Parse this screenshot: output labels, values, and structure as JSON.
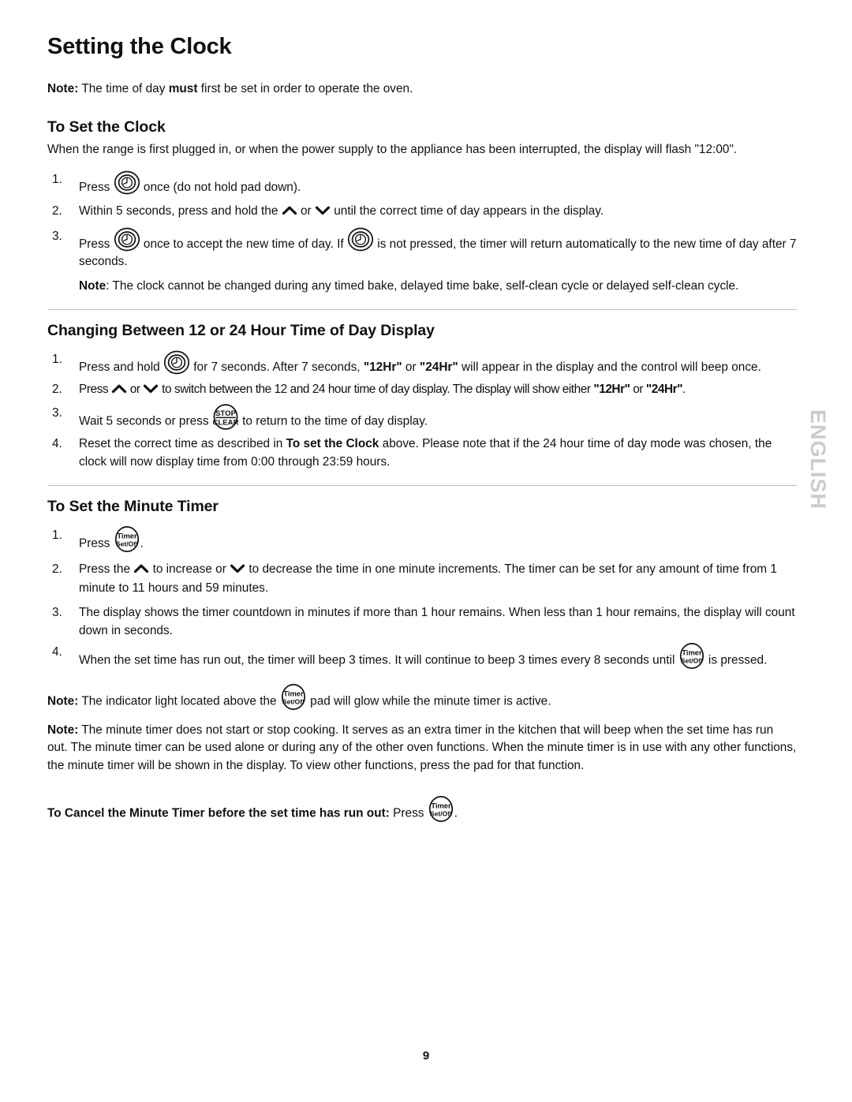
{
  "document": {
    "title": "Setting the Clock",
    "page_number": "9",
    "side_tab_label": "ENGLISH"
  },
  "intro_note": {
    "lead": "Note:",
    "text_before_bold": " The time of day ",
    "bold": "must",
    "text_after_bold": " first be set in order to operate the oven."
  },
  "sections": [
    {
      "heading": "To Set the Clock",
      "intro": "When the range is first plugged in, or when the power supply to the appliance has been interrupted, the display will flash \"12:00\".",
      "steps": [
        {
          "num": "1.",
          "parts": [
            "Press ",
            "[clock-pad-icon]",
            " once (do not hold pad down)."
          ]
        },
        {
          "num": "2.",
          "parts": [
            "Within 5 seconds, press and hold the ",
            "[chevron-up-icon]",
            " or ",
            "[chevron-down-icon]",
            " until the correct time of day appears in the display."
          ]
        },
        {
          "num": "3.",
          "parts": [
            "Press ",
            "[clock-pad-icon]",
            " once to accept the new time of day. If ",
            "[clock-pad-icon]",
            " is not pressed, the timer will return automatically to the new time of day after 7 seconds."
          ]
        }
      ],
      "sub_note": {
        "lead": "Note",
        "text": ": The clock cannot be changed during any timed bake, delayed time bake, self-clean cycle or delayed self-clean cycle."
      }
    },
    {
      "heading": "Changing Between 12 or 24 Hour Time of Day Display",
      "steps": [
        {
          "num": "1.",
          "text_1": "Press and hold ",
          "icon": "[clock-pad-icon]",
          "text_2": " for 7 seconds. After 7 seconds, ",
          "q1": "\"12Hr\"",
          "text_3": " or ",
          "q2": "\"24Hr\"",
          "text_4": " will appear in the display and the control will beep once."
        },
        {
          "num": "2.",
          "text_1": "Press ",
          "icon_up": "[chevron-up-icon]",
          "text_2": " or ",
          "icon_down": "[chevron-down-icon]",
          "text_3": " to switch between the 12 and 24 hour time of day display. The display will show either ",
          "q1": "\"12Hr\"",
          "text_4": " or ",
          "q2": "\"24Hr\"",
          "text_5": "."
        },
        {
          "num": "3.",
          "text_1": "Wait 5 seconds or press ",
          "icon": "[stop-clear-pad-icon]",
          "text_2": " to return to the time of day display."
        },
        {
          "num": "4.",
          "text_1": "Reset the correct time as described in ",
          "bold": "To set the Clock",
          "text_2": " above. Please note that if the 24 hour time of day mode was chosen, the clock will now display time from 0:00 through 23:59 hours."
        }
      ]
    },
    {
      "heading": "To Set the Minute Timer",
      "steps": [
        {
          "num": "1.",
          "text_1": "Press ",
          "icon": "[timer-set-off-pad-icon]",
          "text_2": "."
        },
        {
          "num": "2.",
          "text_1": "Press the ",
          "icon_up": "[chevron-up-icon]",
          "text_2": " to increase or ",
          "icon_down": "[chevron-down-icon]",
          "text_3": " to decrease the time in one minute increments. The timer can be set for any amount of time from 1 minute to 11 hours and 59 minutes."
        },
        {
          "num": "3.",
          "text_1": "The display shows the timer countdown in minutes if more than 1 hour remains. When less than 1 hour remains, the display will count down in seconds."
        },
        {
          "num": "4.",
          "text_1": "When the set time has run out, the timer will beep 3 times. It will continue to beep 3 times every 8 seconds until ",
          "icon": "[timer-set-off-pad-icon]",
          "text_2": " is pressed."
        }
      ],
      "notes": [
        {
          "lead": "Note:",
          "text_1": " The indicator light located above the ",
          "icon": "[timer-set-off-pad-icon]",
          "text_2": " pad will glow while the minute timer is active."
        },
        {
          "lead": "Note:",
          "text_1": " The minute timer does not start or stop cooking. It serves as an extra timer in the kitchen that will beep when the set time has run out. The minute timer can be used alone or during any of the other oven functions. When the minute timer is in use with any other functions, the minute timer will be shown in the display. To view other functions, press the pad for that function."
        }
      ],
      "cancel_line": {
        "bold": "To Cancel the Minute Timer before the set time has run out:",
        "text": " Press ",
        "icon": "[timer-set-off-pad-icon]",
        "tail": "."
      }
    }
  ],
  "pad_labels": {
    "stop": "STOP",
    "clear": "CLEAR",
    "timer": "Timer",
    "set_off": "Set/Off"
  },
  "colors": {
    "text": "#111111",
    "rule": "#b9bcc0",
    "side_tab": "#c9cbcd",
    "page_background": "#ffffff"
  }
}
